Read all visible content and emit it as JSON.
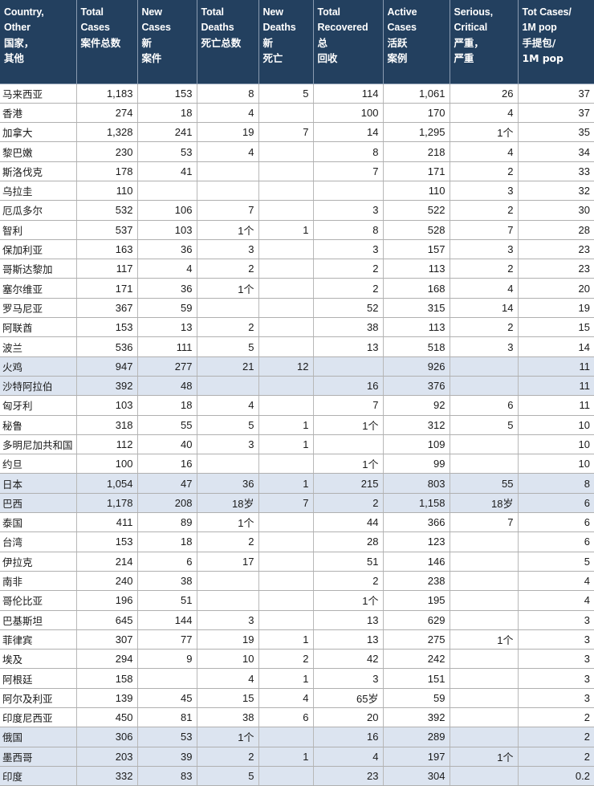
{
  "table": {
    "columns": [
      {
        "key": "country",
        "en1": "Country,",
        "en2": "Other",
        "cn1": "国家，",
        "cn2": "其他"
      },
      {
        "key": "total_cases",
        "en1": "Total",
        "en2": "Cases",
        "cn1": "",
        "cn2": "案件总数"
      },
      {
        "key": "new_cases",
        "en1": "New",
        "en2": "Cases",
        "cn1": "新",
        "cn2": "案件"
      },
      {
        "key": "total_deaths",
        "en1": "Total",
        "en2": "Deaths",
        "cn1": "",
        "cn2": "死亡总数"
      },
      {
        "key": "new_deaths",
        "en1": "New",
        "en2": "Deaths",
        "cn1": "新",
        "cn2": "死亡"
      },
      {
        "key": "total_recovered",
        "en1": "Total",
        "en2": "Recovered",
        "cn1": "总",
        "cn2": "回收"
      },
      {
        "key": "active_cases",
        "en1": "Active",
        "en2": "Cases",
        "cn1": "活跃",
        "cn2": "案例"
      },
      {
        "key": "serious_critical",
        "en1": "Serious,",
        "en2": "Critical",
        "cn1": "严重，",
        "cn2": "严重"
      },
      {
        "key": "tot_cases_per_1m",
        "en1": "Tot Cases/",
        "en2": "1M pop",
        "cn1": "手提包/",
        "cn2": "1M pop"
      }
    ],
    "rows": [
      {
        "highlight": false,
        "country": "马来西亚",
        "total_cases": "1,183",
        "new_cases": "153",
        "total_deaths": "8",
        "new_deaths": "5",
        "total_recovered": "114",
        "active_cases": "1,061",
        "serious_critical": "26",
        "tot_cases_per_1m": "37"
      },
      {
        "highlight": false,
        "country": "香港",
        "total_cases": "274",
        "new_cases": "18",
        "total_deaths": "4",
        "new_deaths": "",
        "total_recovered": "100",
        "active_cases": "170",
        "serious_critical": "4",
        "tot_cases_per_1m": "37"
      },
      {
        "highlight": false,
        "country": "加拿大",
        "total_cases": "1,328",
        "new_cases": "241",
        "total_deaths": "19",
        "new_deaths": "7",
        "total_recovered": "14",
        "active_cases": "1,295",
        "serious_critical": "1个",
        "tot_cases_per_1m": "35"
      },
      {
        "highlight": false,
        "country": "黎巴嫩",
        "total_cases": "230",
        "new_cases": "53",
        "total_deaths": "4",
        "new_deaths": "",
        "total_recovered": "8",
        "active_cases": "218",
        "serious_critical": "4",
        "tot_cases_per_1m": "34"
      },
      {
        "highlight": false,
        "country": "斯洛伐克",
        "total_cases": "178",
        "new_cases": "41",
        "total_deaths": "",
        "new_deaths": "",
        "total_recovered": "7",
        "active_cases": "171",
        "serious_critical": "2",
        "tot_cases_per_1m": "33"
      },
      {
        "highlight": false,
        "country": "乌拉圭",
        "total_cases": "110",
        "new_cases": "",
        "total_deaths": "",
        "new_deaths": "",
        "total_recovered": "",
        "active_cases": "110",
        "serious_critical": "3",
        "tot_cases_per_1m": "32"
      },
      {
        "highlight": false,
        "country": "厄瓜多尔",
        "total_cases": "532",
        "new_cases": "106",
        "total_deaths": "7",
        "new_deaths": "",
        "total_recovered": "3",
        "active_cases": "522",
        "serious_critical": "2",
        "tot_cases_per_1m": "30"
      },
      {
        "highlight": false,
        "country": "智利",
        "total_cases": "537",
        "new_cases": "103",
        "total_deaths": "1个",
        "new_deaths": "1",
        "total_recovered": "8",
        "active_cases": "528",
        "serious_critical": "7",
        "tot_cases_per_1m": "28"
      },
      {
        "highlight": false,
        "country": "保加利亚",
        "total_cases": "163",
        "new_cases": "36",
        "total_deaths": "3",
        "new_deaths": "",
        "total_recovered": "3",
        "active_cases": "157",
        "serious_critical": "3",
        "tot_cases_per_1m": "23"
      },
      {
        "highlight": false,
        "country": "哥斯达黎加",
        "total_cases": "117",
        "new_cases": "4",
        "total_deaths": "2",
        "new_deaths": "",
        "total_recovered": "2",
        "active_cases": "113",
        "serious_critical": "2",
        "tot_cases_per_1m": "23"
      },
      {
        "highlight": false,
        "country": "塞尔维亚",
        "total_cases": "171",
        "new_cases": "36",
        "total_deaths": "1个",
        "new_deaths": "",
        "total_recovered": "2",
        "active_cases": "168",
        "serious_critical": "4",
        "tot_cases_per_1m": "20"
      },
      {
        "highlight": false,
        "country": "罗马尼亚",
        "total_cases": "367",
        "new_cases": "59",
        "total_deaths": "",
        "new_deaths": "",
        "total_recovered": "52",
        "active_cases": "315",
        "serious_critical": "14",
        "tot_cases_per_1m": "19"
      },
      {
        "highlight": false,
        "country": "阿联酋",
        "total_cases": "153",
        "new_cases": "13",
        "total_deaths": "2",
        "new_deaths": "",
        "total_recovered": "38",
        "active_cases": "113",
        "serious_critical": "2",
        "tot_cases_per_1m": "15"
      },
      {
        "highlight": false,
        "country": "波兰",
        "total_cases": "536",
        "new_cases": "111",
        "total_deaths": "5",
        "new_deaths": "",
        "total_recovered": "13",
        "active_cases": "518",
        "serious_critical": "3",
        "tot_cases_per_1m": "14"
      },
      {
        "highlight": true,
        "country": "火鸡",
        "total_cases": "947",
        "new_cases": "277",
        "total_deaths": "21",
        "new_deaths": "12",
        "total_recovered": "",
        "active_cases": "926",
        "serious_critical": "",
        "tot_cases_per_1m": "11"
      },
      {
        "highlight": true,
        "country": "沙特阿拉伯",
        "total_cases": "392",
        "new_cases": "48",
        "total_deaths": "",
        "new_deaths": "",
        "total_recovered": "16",
        "active_cases": "376",
        "serious_critical": "",
        "tot_cases_per_1m": "11"
      },
      {
        "highlight": false,
        "country": "匈牙利",
        "total_cases": "103",
        "new_cases": "18",
        "total_deaths": "4",
        "new_deaths": "",
        "total_recovered": "7",
        "active_cases": "92",
        "serious_critical": "6",
        "tot_cases_per_1m": "11"
      },
      {
        "highlight": false,
        "country": "秘鲁",
        "total_cases": "318",
        "new_cases": "55",
        "total_deaths": "5",
        "new_deaths": "1",
        "total_recovered": "1个",
        "active_cases": "312",
        "serious_critical": "5",
        "tot_cases_per_1m": "10"
      },
      {
        "highlight": false,
        "country": "多明尼加共和国",
        "total_cases": "112",
        "new_cases": "40",
        "total_deaths": "3",
        "new_deaths": "1",
        "total_recovered": "",
        "active_cases": "109",
        "serious_critical": "",
        "tot_cases_per_1m": "10"
      },
      {
        "highlight": false,
        "country": "约旦",
        "total_cases": "100",
        "new_cases": "16",
        "total_deaths": "",
        "new_deaths": "",
        "total_recovered": "1个",
        "active_cases": "99",
        "serious_critical": "",
        "tot_cases_per_1m": "10"
      },
      {
        "highlight": true,
        "country": "日本",
        "total_cases": "1,054",
        "new_cases": "47",
        "total_deaths": "36",
        "new_deaths": "1",
        "total_recovered": "215",
        "active_cases": "803",
        "serious_critical": "55",
        "tot_cases_per_1m": "8"
      },
      {
        "highlight": true,
        "country": "巴西",
        "total_cases": "1,178",
        "new_cases": "208",
        "total_deaths": "18岁",
        "new_deaths": "7",
        "total_recovered": "2",
        "active_cases": "1,158",
        "serious_critical": "18岁",
        "tot_cases_per_1m": "6"
      },
      {
        "highlight": false,
        "country": "泰国",
        "total_cases": "411",
        "new_cases": "89",
        "total_deaths": "1个",
        "new_deaths": "",
        "total_recovered": "44",
        "active_cases": "366",
        "serious_critical": "7",
        "tot_cases_per_1m": "6"
      },
      {
        "highlight": false,
        "country": "台湾",
        "total_cases": "153",
        "new_cases": "18",
        "total_deaths": "2",
        "new_deaths": "",
        "total_recovered": "28",
        "active_cases": "123",
        "serious_critical": "",
        "tot_cases_per_1m": "6"
      },
      {
        "highlight": false,
        "country": "伊拉克",
        "total_cases": "214",
        "new_cases": "6",
        "total_deaths": "17",
        "new_deaths": "",
        "total_recovered": "51",
        "active_cases": "146",
        "serious_critical": "",
        "tot_cases_per_1m": "5"
      },
      {
        "highlight": false,
        "country": "南非",
        "total_cases": "240",
        "new_cases": "38",
        "total_deaths": "",
        "new_deaths": "",
        "total_recovered": "2",
        "active_cases": "238",
        "serious_critical": "",
        "tot_cases_per_1m": "4"
      },
      {
        "highlight": false,
        "country": "哥伦比亚",
        "total_cases": "196",
        "new_cases": "51",
        "total_deaths": "",
        "new_deaths": "",
        "total_recovered": "1个",
        "active_cases": "195",
        "serious_critical": "",
        "tot_cases_per_1m": "4"
      },
      {
        "highlight": false,
        "country": "巴基斯坦",
        "total_cases": "645",
        "new_cases": "144",
        "total_deaths": "3",
        "new_deaths": "",
        "total_recovered": "13",
        "active_cases": "629",
        "serious_critical": "",
        "tot_cases_per_1m": "3"
      },
      {
        "highlight": false,
        "country": "菲律宾",
        "total_cases": "307",
        "new_cases": "77",
        "total_deaths": "19",
        "new_deaths": "1",
        "total_recovered": "13",
        "active_cases": "275",
        "serious_critical": "1个",
        "tot_cases_per_1m": "3"
      },
      {
        "highlight": false,
        "country": "埃及",
        "total_cases": "294",
        "new_cases": "9",
        "total_deaths": "10",
        "new_deaths": "2",
        "total_recovered": "42",
        "active_cases": "242",
        "serious_critical": "",
        "tot_cases_per_1m": "3"
      },
      {
        "highlight": false,
        "country": "阿根廷",
        "total_cases": "158",
        "new_cases": "",
        "total_deaths": "4",
        "new_deaths": "1",
        "total_recovered": "3",
        "active_cases": "151",
        "serious_critical": "",
        "tot_cases_per_1m": "3"
      },
      {
        "highlight": false,
        "country": "阿尔及利亚",
        "total_cases": "139",
        "new_cases": "45",
        "total_deaths": "15",
        "new_deaths": "4",
        "total_recovered": "65岁",
        "active_cases": "59",
        "serious_critical": "",
        "tot_cases_per_1m": "3"
      },
      {
        "highlight": false,
        "country": "印度尼西亚",
        "total_cases": "450",
        "new_cases": "81",
        "total_deaths": "38",
        "new_deaths": "6",
        "total_recovered": "20",
        "active_cases": "392",
        "serious_critical": "",
        "tot_cases_per_1m": "2"
      },
      {
        "highlight": true,
        "country": "俄国",
        "total_cases": "306",
        "new_cases": "53",
        "total_deaths": "1个",
        "new_deaths": "",
        "total_recovered": "16",
        "active_cases": "289",
        "serious_critical": "",
        "tot_cases_per_1m": "2"
      },
      {
        "highlight": true,
        "country": "墨西哥",
        "total_cases": "203",
        "new_cases": "39",
        "total_deaths": "2",
        "new_deaths": "1",
        "total_recovered": "4",
        "active_cases": "197",
        "serious_critical": "1个",
        "tot_cases_per_1m": "2"
      },
      {
        "highlight": true,
        "country": "印度",
        "total_cases": "332",
        "new_cases": "83",
        "total_deaths": "5",
        "new_deaths": "",
        "total_recovered": "23",
        "active_cases": "304",
        "serious_critical": "",
        "tot_cases_per_1m": "0.2"
      }
    ]
  },
  "colors": {
    "header_bg": "#23405F",
    "header_text": "#FFFFFF",
    "row_highlight": "#DCE4F0",
    "grid": "#B0B0B0"
  }
}
